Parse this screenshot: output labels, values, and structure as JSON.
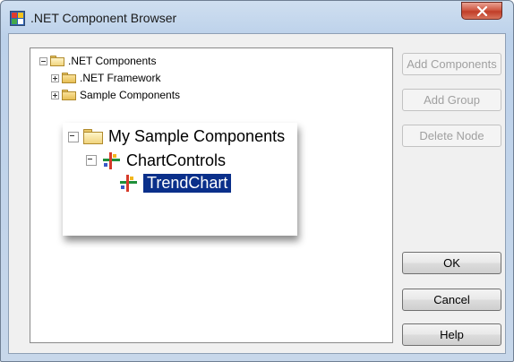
{
  "window": {
    "title": ".NET Component Browser"
  },
  "tree": {
    "root": ".NET Components",
    "items": [
      ".NET Framework",
      "Sample Components"
    ]
  },
  "zoom": {
    "folder": "My Sample Components",
    "group": "ChartControls",
    "selected": "TrendChart"
  },
  "buttons": {
    "add_components": "Add Components",
    "add_group": "Add Group",
    "delete_node": "Delete Node",
    "ok": "OK",
    "cancel": "Cancel",
    "help": "Help"
  },
  "colors": {
    "selection": "#0a2f8a",
    "title_bar": "#bcd1ea",
    "close_button": "#c03d28"
  },
  "icons": [
    "app-icon",
    "close-icon",
    "folder-icon",
    "expand-collapse-icon",
    "component-icon"
  ]
}
